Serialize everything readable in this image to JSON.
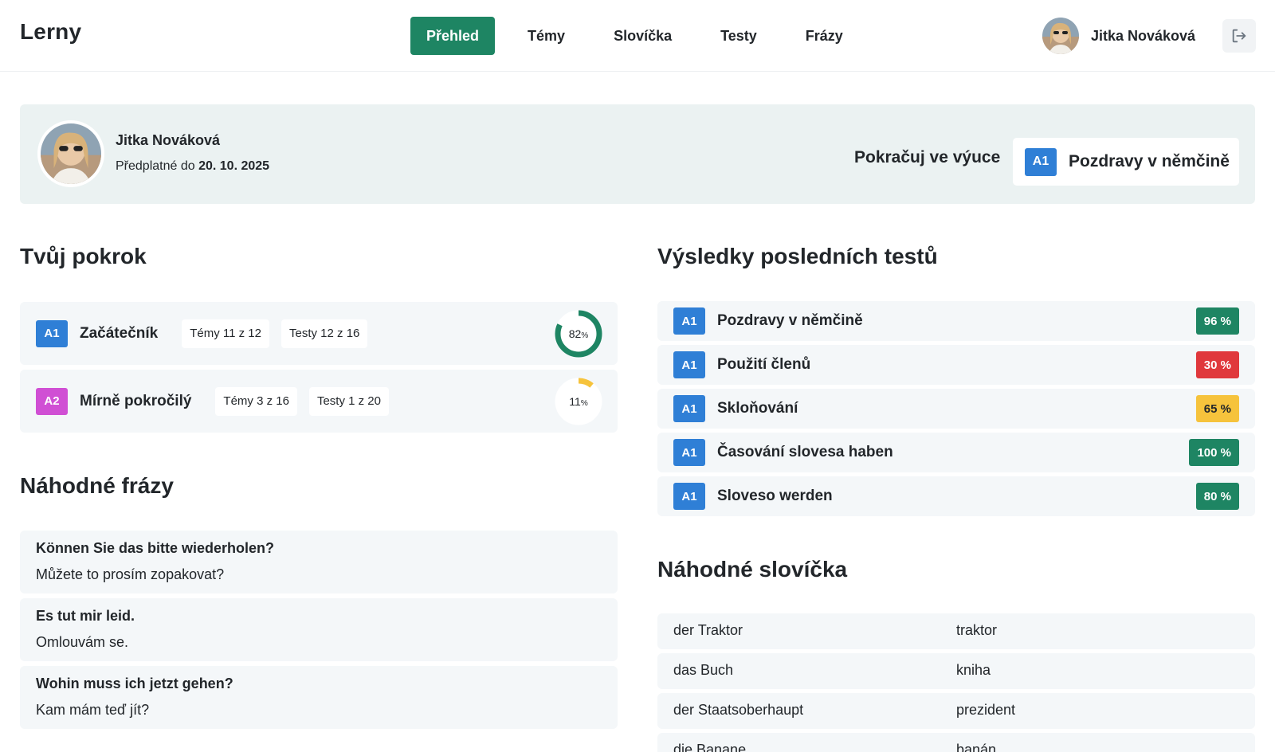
{
  "app": {
    "logo": "Lerny"
  },
  "nav": {
    "items": [
      {
        "label": "Přehled",
        "active": true
      },
      {
        "label": "Témy",
        "active": false
      },
      {
        "label": "Slovíčka",
        "active": false
      },
      {
        "label": "Testy",
        "active": false
      },
      {
        "label": "Frázy",
        "active": false
      }
    ]
  },
  "user": {
    "name": "Jitka Nováková",
    "subscription_prefix": "Předplatné do",
    "subscription_date": "20. 10. 2025"
  },
  "continue": {
    "label": "Pokračuj ve výuce",
    "level": "A1",
    "title": "Pozdravy v němčině"
  },
  "progress": {
    "heading": "Tvůj pokrok",
    "rows": [
      {
        "level": "A1",
        "name": "Začátečník",
        "topics": "Témy 11 z 12",
        "tests": "Testy 12 z 16",
        "percent": 82,
        "percent_label": "82",
        "ring_color": "#1e8563"
      },
      {
        "level": "A2",
        "name": "Mírně pokročilý",
        "topics": "Témy 3 z 16",
        "tests": "Testy 1 z 20",
        "percent": 11,
        "percent_label": "11",
        "ring_color": "#f6c33c"
      }
    ],
    "percent_sign": "%"
  },
  "tests": {
    "heading": "Výsledky posledních testů",
    "rows": [
      {
        "level": "A1",
        "title": "Pozdravy v němčině",
        "score": "96 %",
        "status": "good"
      },
      {
        "level": "A1",
        "title": "Použití členů",
        "score": "30 %",
        "status": "bad"
      },
      {
        "level": "A1",
        "title": "Skloňování",
        "score": "65 %",
        "status": "mid"
      },
      {
        "level": "A1",
        "title": "Časování slovesa haben",
        "score": "100 %",
        "status": "good"
      },
      {
        "level": "A1",
        "title": "Sloveso werden",
        "score": "80 %",
        "status": "good"
      }
    ]
  },
  "phrases": {
    "heading": "Náhodné frázy",
    "rows": [
      {
        "de": "Können Sie das bitte wiederholen?",
        "cs": "Můžete to prosím zopakovat?"
      },
      {
        "de": "Es tut mir leid.",
        "cs": "Omlouvám se."
      },
      {
        "de": "Wohin muss ich jetzt gehen?",
        "cs": "Kam mám teď jít?"
      }
    ]
  },
  "vocab": {
    "heading": "Náhodné slovíčka",
    "rows": [
      {
        "de": "der Traktor",
        "cs": "traktor"
      },
      {
        "de": "das Buch",
        "cs": "kniha"
      },
      {
        "de": "der Staatsoberhaupt",
        "cs": "prezident"
      },
      {
        "de": "die Banane",
        "cs": "banán"
      }
    ]
  },
  "icons": {
    "logout": "logout-icon",
    "avatar": "user-avatar"
  },
  "colors": {
    "primary": "#1e8563",
    "a1": "#2f7fd6",
    "a2": "#d04fd4",
    "bad": "#e0383c",
    "mid": "#f6c33c"
  }
}
